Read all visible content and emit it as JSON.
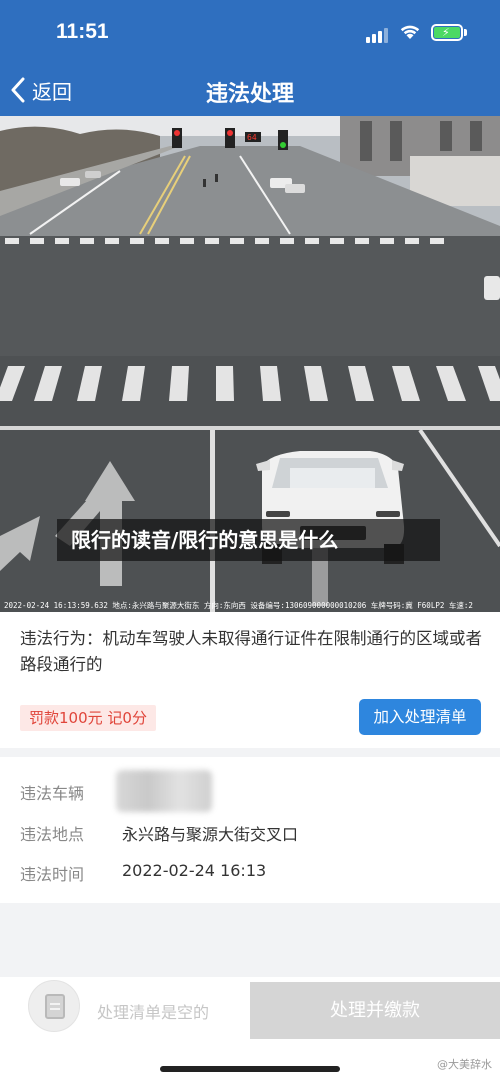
{
  "status_bar": {
    "time": "11:51"
  },
  "nav": {
    "back_label": "返回",
    "title": "违法处理"
  },
  "photo": {
    "meta_text": "2022-02-24 16:13:59.632  地点:永兴路与聚源大街东  方向:东向西  设备编号:130609000000010206  车牌号码:冀 F60LP2  车速:2",
    "signal_countdown": "64"
  },
  "overlay": {
    "banner_text": "限行的读音/限行的意思是什么"
  },
  "violation": {
    "description": "违法行为：机动车驾驶人未取得通行证件在限制通行的区域或者路段通行的",
    "fine_text": "罚款100元  记0分",
    "add_button_label": "加入处理清单"
  },
  "details": {
    "vehicle_label": "违法车辆",
    "location_label": "违法地点",
    "location_value": "永兴路与聚源大街交叉口",
    "time_label": "违法时间",
    "time_value": "2022-02-24 16:13"
  },
  "bottom_bar": {
    "cart_empty_text": "处理清单是空的",
    "pay_button_label": "处理并缴款",
    "watermark": "@大美辞水"
  },
  "colors": {
    "header_blue": "#2f6fbf",
    "button_blue": "#2e86de",
    "fine_red": "#e0453a"
  }
}
